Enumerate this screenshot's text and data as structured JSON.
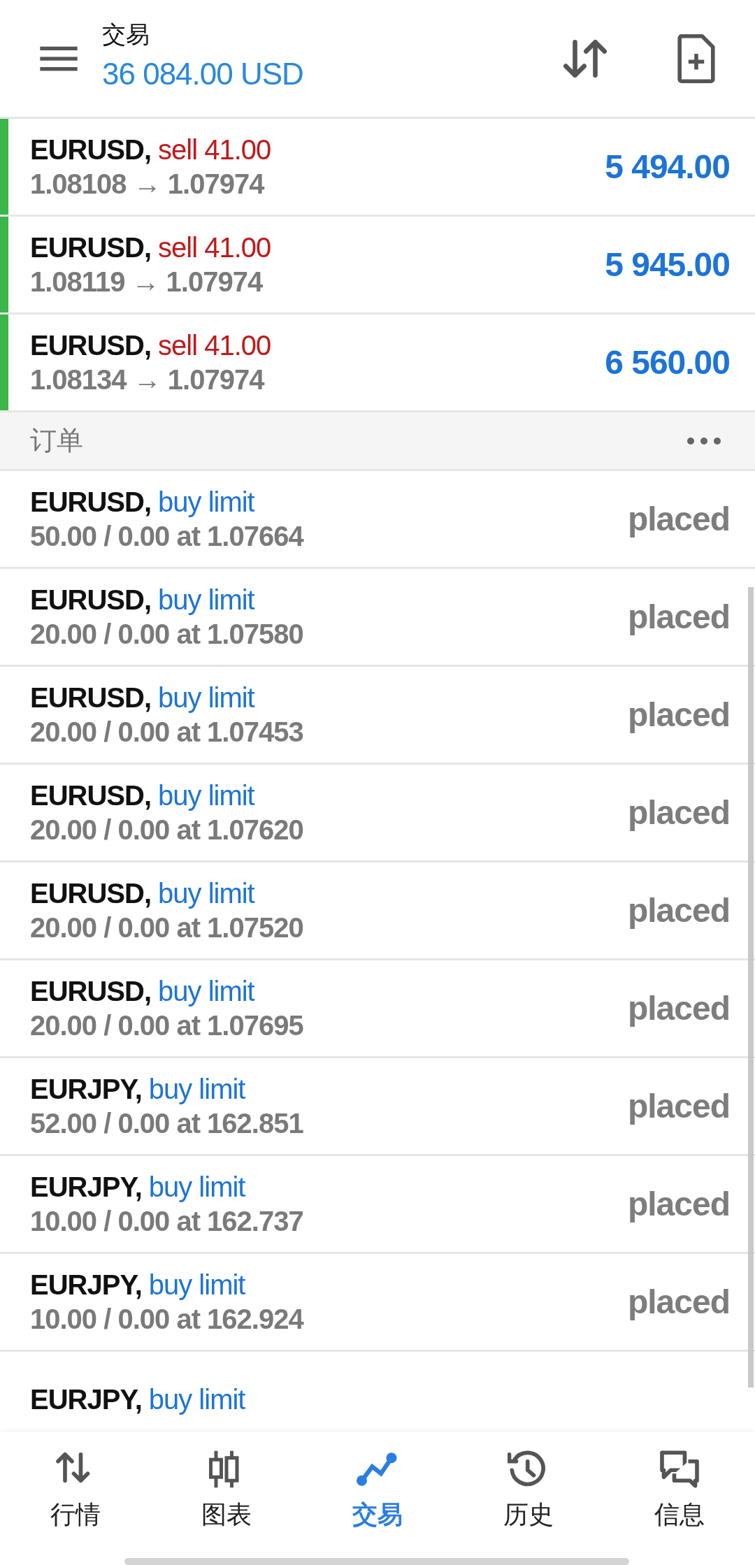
{
  "header": {
    "title": "交易",
    "balance": "36 084.00 USD"
  },
  "positions": [
    {
      "symbol": "EURUSD,",
      "action": "sell 41.00",
      "prices": "1.08108 → 1.07974",
      "profit": "5 494.00"
    },
    {
      "symbol": "EURUSD,",
      "action": "sell 41.00",
      "prices": "1.08119 → 1.07974",
      "profit": "5 945.00"
    },
    {
      "symbol": "EURUSD,",
      "action": "sell 41.00",
      "prices": "1.08134 → 1.07974",
      "profit": "6 560.00"
    }
  ],
  "orders_section": {
    "title": "订单"
  },
  "orders": [
    {
      "symbol": "EURUSD,",
      "type": "buy limit",
      "details": "50.00 / 0.00 at 1.07664",
      "status": "placed"
    },
    {
      "symbol": "EURUSD,",
      "type": "buy limit",
      "details": "20.00 / 0.00 at 1.07580",
      "status": "placed"
    },
    {
      "symbol": "EURUSD,",
      "type": "buy limit",
      "details": "20.00 / 0.00 at 1.07453",
      "status": "placed"
    },
    {
      "symbol": "EURUSD,",
      "type": "buy limit",
      "details": "20.00 / 0.00 at 1.07620",
      "status": "placed"
    },
    {
      "symbol": "EURUSD,",
      "type": "buy limit",
      "details": "20.00 / 0.00 at 1.07520",
      "status": "placed"
    },
    {
      "symbol": "EURUSD,",
      "type": "buy limit",
      "details": "20.00 / 0.00 at 1.07695",
      "status": "placed"
    },
    {
      "symbol": "EURJPY,",
      "type": "buy limit",
      "details": "52.00 / 0.00 at 162.851",
      "status": "placed"
    },
    {
      "symbol": "EURJPY,",
      "type": "buy limit",
      "details": "10.00 / 0.00 at 162.737",
      "status": "placed"
    },
    {
      "symbol": "EURJPY,",
      "type": "buy limit",
      "details": "10.00 / 0.00 at 162.924",
      "status": "placed"
    },
    {
      "symbol": "EURJPY,",
      "type": "buy limit"
    }
  ],
  "bottom_nav": [
    {
      "label": "行情",
      "selected": false
    },
    {
      "label": "图表",
      "selected": false
    },
    {
      "label": "交易",
      "selected": true
    },
    {
      "label": "历史",
      "selected": false
    },
    {
      "label": "信息",
      "selected": false
    }
  ]
}
